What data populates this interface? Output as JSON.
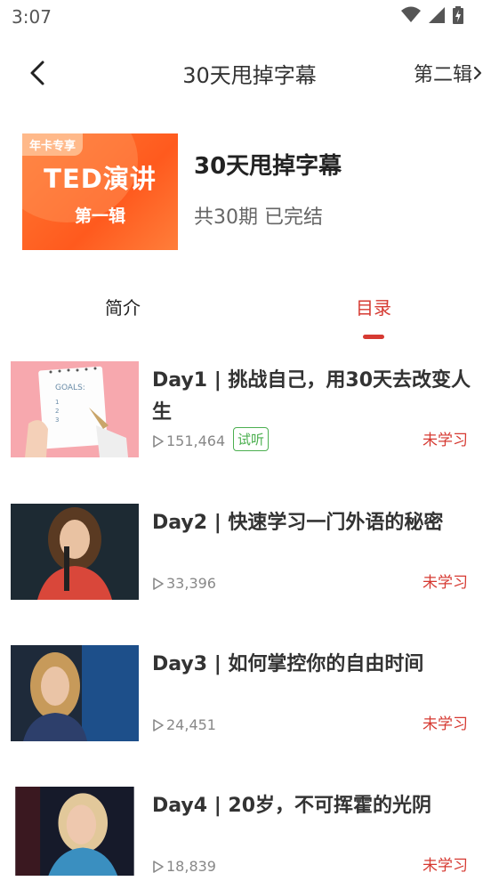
{
  "status_bar": {
    "time": "3:07",
    "icons": [
      "wifi-icon",
      "signal-icon",
      "battery-icon"
    ]
  },
  "nav": {
    "title": "30天甩掉字幕",
    "next_label": "第二辑"
  },
  "album": {
    "cover_tag": "年卡专享",
    "cover_main": "TED演讲",
    "cover_sub": "第一辑",
    "title": "30天甩掉字幕",
    "meta": "共30期 已完结"
  },
  "tabs": [
    {
      "label": "简介",
      "active": false
    },
    {
      "label": "目录",
      "active": true
    }
  ],
  "lessons": [
    {
      "title": "Day1 | 挑战自己，用30天去改变人生",
      "plays": "151,464",
      "badge": "试听",
      "status": "未学习"
    },
    {
      "title": "Day2 | 快速学习一门外语的秘密",
      "plays": "33,396",
      "status": "未学习"
    },
    {
      "title": "Day3 | 如何掌控你的自由时间",
      "plays": "24,451",
      "status": "未学习"
    },
    {
      "title": "Day4 | 20岁，不可挥霍的光阴",
      "plays": "18,839",
      "status": "未学习"
    }
  ],
  "colors": {
    "accent": "#d63a32",
    "trial": "#4caf50",
    "cover": "#ff5a1e"
  }
}
